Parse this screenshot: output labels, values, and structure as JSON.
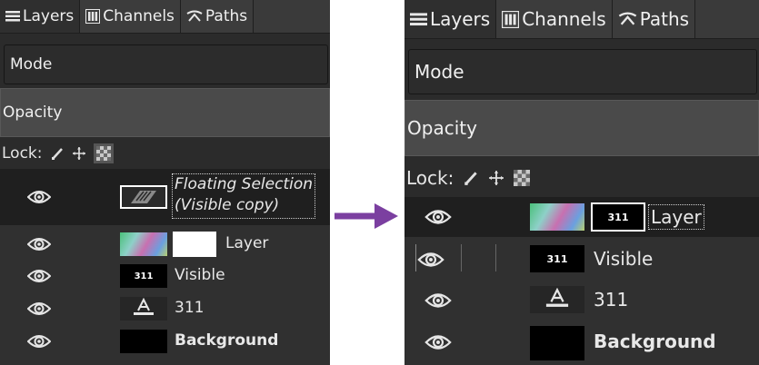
{
  "tabs": [
    {
      "label": "Layers",
      "icon": "layers-icon"
    },
    {
      "label": "Channels",
      "icon": "channels-icon"
    },
    {
      "label": "Paths",
      "icon": "paths-icon"
    }
  ],
  "mode_label": "Mode",
  "opacity_label": "Opacity",
  "lock_label": "Lock:",
  "lock_icons": [
    "lock-pixels-icon",
    "lock-position-icon",
    "lock-alpha-icon"
  ],
  "before": {
    "layers": [
      {
        "name_line1": "Floating Selection",
        "name_line2": "(Visible copy)",
        "style": "italic",
        "selected": true
      },
      {
        "name": "Layer",
        "style": "normal"
      },
      {
        "name": "Visible",
        "thumb_text": "311",
        "style": "normal"
      },
      {
        "name": "311",
        "style": "normal"
      },
      {
        "name": "Background",
        "style": "bold"
      }
    ]
  },
  "after": {
    "layers": [
      {
        "name": "Layer",
        "mask_text": "311",
        "style": "normal",
        "selected": true
      },
      {
        "name": "Visible",
        "thumb_text": "311",
        "style": "normal"
      },
      {
        "name": "311",
        "style": "normal"
      },
      {
        "name": "Background",
        "style": "bold"
      }
    ]
  },
  "colors": {
    "panel_bg": "#2b2b2b",
    "selected_row": "#1f1f1f",
    "arrow": "#7b3fa0",
    "text": "#e6e6e6"
  }
}
